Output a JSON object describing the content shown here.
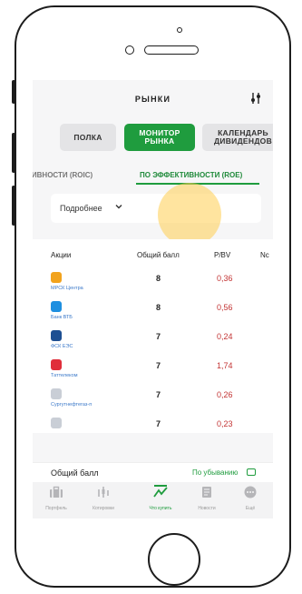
{
  "header": {
    "title": "РЫНКИ"
  },
  "segments": {
    "polka": "ПОЛКА",
    "monitor": "МОНИТОР\nРЫНКА",
    "calendar": "КАЛЕНДАРЬ\nДИВИДЕНДОВ"
  },
  "tabs": {
    "roic": "ТИВНОСТИ (ROIC)",
    "roe": "ПО ЭФФЕКТИВНОСТИ (ROE)"
  },
  "dropdown": {
    "label": "Подробнее"
  },
  "table": {
    "columns": [
      "Акции",
      "Общий балл",
      "P/BV",
      "Nc"
    ],
    "rows": [
      {
        "name": "МРСК Центра",
        "score": "8",
        "pbv": "0,36",
        "icon_color": "#f2a31d"
      },
      {
        "name": "Банк ВТБ",
        "score": "8",
        "pbv": "0,56",
        "icon_color": "#1e8fe0"
      },
      {
        "name": "ФСК ЕЭС",
        "score": "7",
        "pbv": "0,24",
        "icon_color": "#1d4f92"
      },
      {
        "name": "Таттелеком",
        "score": "7",
        "pbv": "1,74",
        "icon_color": "#e02e3b"
      },
      {
        "name": "Сургутнефтегаз-п",
        "score": "7",
        "pbv": "0,26",
        "icon_color": "#c9ced6"
      },
      {
        "name": "",
        "score": "7",
        "pbv": "0,23",
        "icon_color": "#c9ced6"
      }
    ]
  },
  "sort": {
    "label": "Общий балл",
    "direction": "По убыванию"
  },
  "bottom_nav": [
    {
      "label": "Портфель",
      "icon": "briefcase-icon"
    },
    {
      "label": "Котировки",
      "icon": "quotes-icon"
    },
    {
      "label": "Что купить",
      "icon": "trend-icon",
      "active": true
    },
    {
      "label": "Новости",
      "icon": "news-icon"
    },
    {
      "label": "Ещё",
      "icon": "more-icon"
    }
  ],
  "colors": {
    "accent": "#1f9c3e",
    "negative": "#c33434",
    "link": "#3a78c9"
  }
}
